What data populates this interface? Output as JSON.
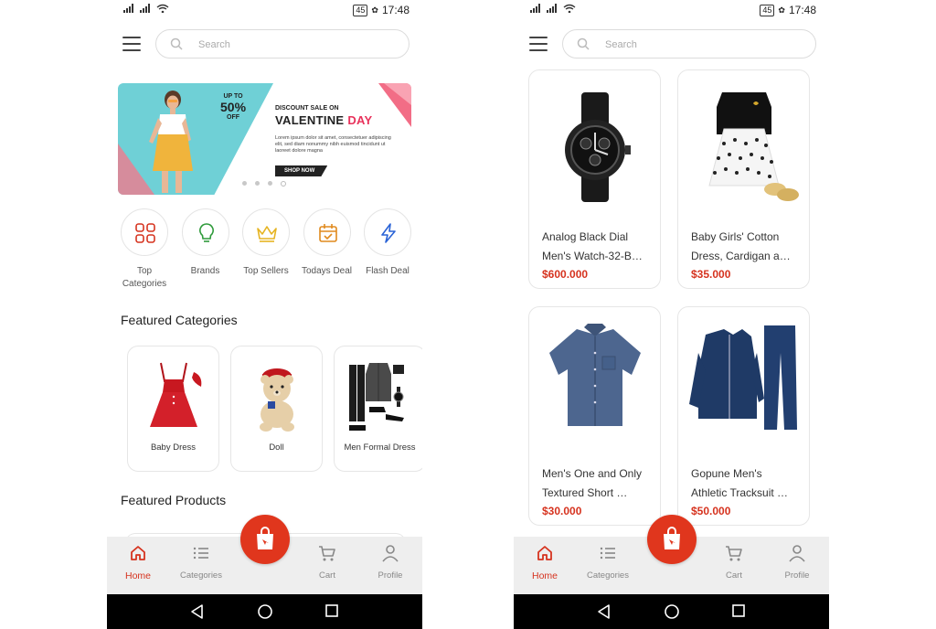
{
  "status": {
    "battery": "45",
    "time": "17:48"
  },
  "search": {
    "placeholder": "Search"
  },
  "banner": {
    "upto": "UP TO",
    "discount": "50%",
    "off": "OFF",
    "headline_small": "DISCOUNT SALE ON",
    "headline_word1": "VALENTINE",
    "headline_word2": "DAY",
    "description": "Lorem ipsum dolor sit amet, consectetuer adipiscing elit, sed diam nonummy nibh euismod tincidunt ut laoreet dolore magna",
    "cta": "SHOP NOW",
    "colors": {
      "teal": "#6fd0d6",
      "pink": "#e8325b"
    }
  },
  "quick_categories": [
    {
      "label": "Top Categories",
      "icon": "grid-icon"
    },
    {
      "label": "Brands",
      "icon": "lightbulb-icon"
    },
    {
      "label": "Top Sellers",
      "icon": "crown-icon"
    },
    {
      "label": "Todays Deal",
      "icon": "calendar-check-icon"
    },
    {
      "label": "Flash Deal",
      "icon": "lightning-icon"
    }
  ],
  "featured_categories_title": "Featured Categories",
  "featured_categories": [
    {
      "label": "Baby Dress"
    },
    {
      "label": "Doll"
    },
    {
      "label": "Men Formal Dress"
    }
  ],
  "featured_products_title": "Featured Products",
  "products": [
    {
      "name_line1": "Analog Black Dial",
      "name_line2": "Men's Watch-32-B…",
      "price": "$600.000"
    },
    {
      "name_line1": "Baby Girls' Cotton",
      "name_line2": "Dress, Cardigan a…",
      "price": "$35.000"
    },
    {
      "name_line1": "Men's One and Only",
      "name_line2": "Textured Short …",
      "price": "$30.000"
    },
    {
      "name_line1": "Gopune Men's",
      "name_line2": "Athletic Tracksuit …",
      "price": "$50.000"
    }
  ],
  "nav": {
    "home": "Home",
    "categories": "Categories",
    "cart": "Cart",
    "profile": "Profile"
  },
  "accent_color": "#d6331f"
}
